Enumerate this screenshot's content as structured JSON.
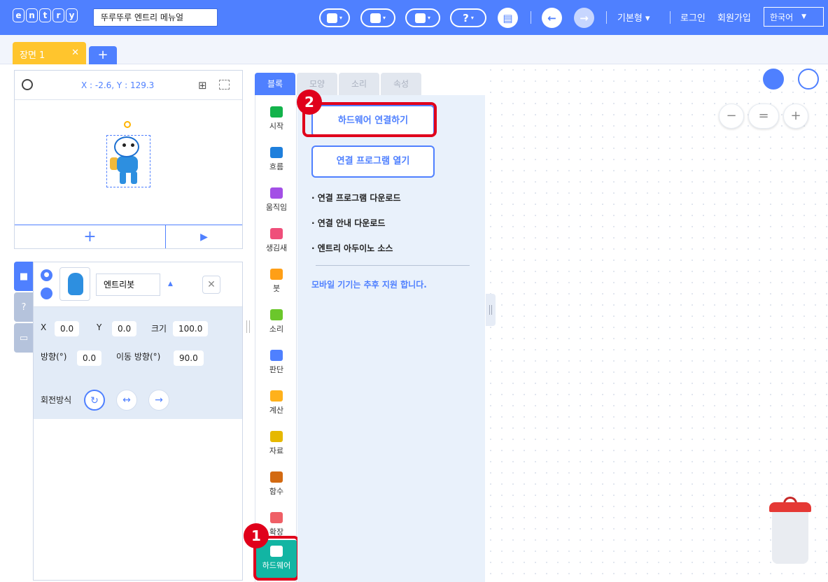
{
  "header": {
    "logo_letters": [
      "e",
      "n",
      "t",
      "r",
      "y"
    ],
    "project_title": "뚜루뚜루 엔트리 메뉴얼",
    "help_label": "?",
    "mode_label": "기본형 ▾",
    "login_label": "로그인",
    "signup_label": "회원가입",
    "language_label": "한국어",
    "language_caret": "▼"
  },
  "scenes": {
    "tab_label": "장면 1",
    "close_label": "✕",
    "add_label": "+"
  },
  "stage": {
    "coordinates": "X : -2.6, Y : 129.3",
    "add_label": "+",
    "play_label": "▶"
  },
  "object": {
    "name": "엔트리봇",
    "x_label": "X",
    "x_value": "0.0",
    "y_label": "Y",
    "y_value": "0.0",
    "size_label": "크기",
    "size_value": "100.0",
    "direction_label": "방향(°)",
    "direction_value": "0.0",
    "move_direction_label": "이동 방향(°)",
    "move_direction_value": "90.0",
    "rotation_label": "회전방식"
  },
  "block_tabs": [
    "블록",
    "모양",
    "소리",
    "속성"
  ],
  "categories": [
    {
      "label": "시작",
      "color": "#13b34b"
    },
    {
      "label": "흐름",
      "color": "#1e7fdc"
    },
    {
      "label": "움직임",
      "color": "#a34fe6"
    },
    {
      "label": "생김새",
      "color": "#ef4f7a"
    },
    {
      "label": "붓",
      "color": "#ff9f16"
    },
    {
      "label": "소리",
      "color": "#6bc72b"
    },
    {
      "label": "판단",
      "color": "#4f80ff"
    },
    {
      "label": "계산",
      "color": "#ffb11b"
    },
    {
      "label": "자료",
      "color": "#e6b800"
    },
    {
      "label": "함수",
      "color": "#d36a12"
    },
    {
      "label": "확장",
      "color": "#ef5f66"
    },
    {
      "label": "하드웨어",
      "color": "#12b5a3"
    }
  ],
  "hardware": {
    "connect_button": "하드웨어 연결하기",
    "open_program_button": "연결 프로그램 열기",
    "links": [
      "· 연결 프로그램 다운로드",
      "· 연결 안내 다운로드",
      "· 엔트리 아두이노 소스"
    ],
    "mobile_note": "모바일 기기는 추후 지원 합니다."
  },
  "zoom": {
    "out_label": "−",
    "reset_label": "=",
    "in_label": "+"
  },
  "annotations": {
    "step1": "1",
    "step2": "2"
  }
}
